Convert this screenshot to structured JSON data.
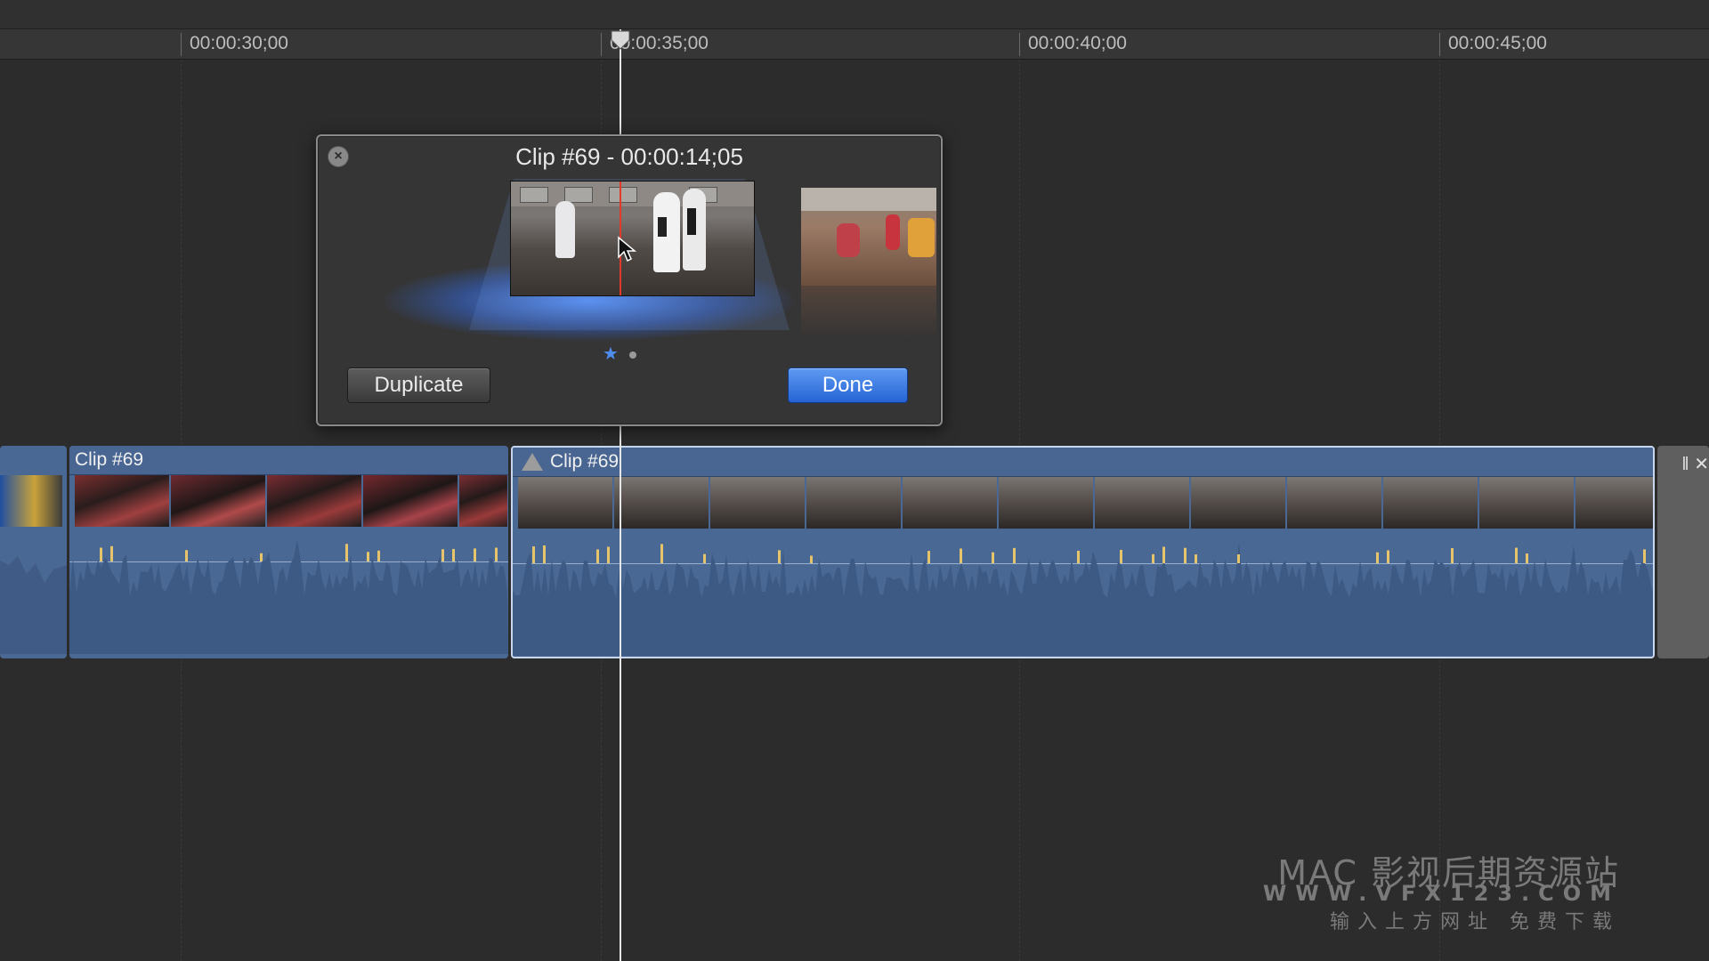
{
  "ruler": {
    "ticks": [
      "00:00:30;00",
      "00:00:35;00",
      "00:00:40;00",
      "00:00:45;00"
    ]
  },
  "popover": {
    "title": "Clip #69 - 00:00:14;05",
    "duplicate_label": "Duplicate",
    "done_label": "Done",
    "page_count": 2,
    "current_page": 1
  },
  "timeline": {
    "clips": [
      {
        "name": "Clip #69"
      },
      {
        "name": "Clip #69"
      }
    ]
  },
  "watermark": {
    "line1": "MAC 影视后期资源站",
    "line2": "WWW.VFX123.COM",
    "line3": "输入上方网址 免费下载"
  },
  "colors": {
    "accent": "#2563d4",
    "clip": "#4a6894",
    "audio_peak": "#e6c46a"
  }
}
